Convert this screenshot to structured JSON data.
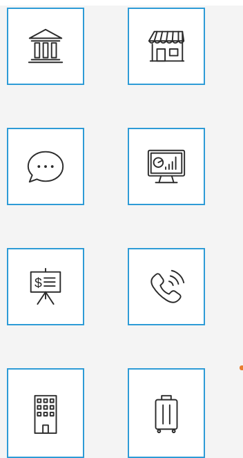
{
  "tiles": [
    {
      "id": "bank",
      "icon": "bank-building-icon"
    },
    {
      "id": "storefront",
      "icon": "storefront-icon"
    },
    {
      "id": "chat",
      "icon": "chat-bubble-icon"
    },
    {
      "id": "analytics-monitor",
      "icon": "analytics-monitor-icon"
    },
    {
      "id": "finance-presentation",
      "icon": "finance-presentation-board-icon"
    },
    {
      "id": "phone-call",
      "icon": "phone-call-icon"
    },
    {
      "id": "office-building",
      "icon": "office-building-icon"
    },
    {
      "id": "luggage",
      "icon": "luggage-suitcase-icon"
    }
  ],
  "colors": {
    "tile_border": "#2d9bd6",
    "icon_stroke": "#2b2b2b",
    "background": "#f4f4f4",
    "accent": "#e87d2e"
  },
  "presentation_board": {
    "symbol": "$"
  }
}
